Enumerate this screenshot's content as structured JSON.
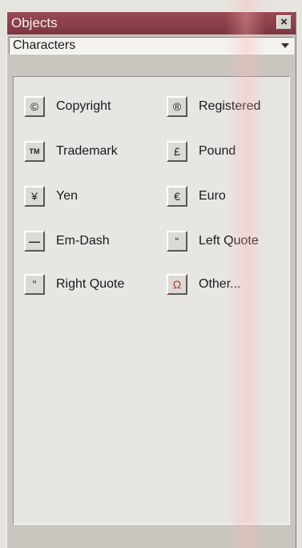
{
  "window": {
    "title": "Objects",
    "close_symbol": "×"
  },
  "dropdown": {
    "selected": "Characters"
  },
  "items": [
    {
      "label": "Copyright",
      "icon": "copyright-icon",
      "glyph": "©"
    },
    {
      "label": "Registered",
      "icon": "registered-icon",
      "glyph": "®"
    },
    {
      "label": "Trademark",
      "icon": "trademark-icon",
      "glyph": "TM"
    },
    {
      "label": "Pound",
      "icon": "pound-icon",
      "glyph": "£"
    },
    {
      "label": "Yen",
      "icon": "yen-icon",
      "glyph": "¥"
    },
    {
      "label": "Euro",
      "icon": "euro-icon",
      "glyph": "€"
    },
    {
      "label": "Em-Dash",
      "icon": "em-dash-icon",
      "glyph": "—"
    },
    {
      "label": "Left Quote",
      "icon": "left-quote-icon",
      "glyph": "“"
    },
    {
      "label": "Right Quote",
      "icon": "right-quote-icon",
      "glyph": "”"
    },
    {
      "label": "Other...",
      "icon": "other-characters-icon",
      "glyph": "Ω"
    }
  ],
  "colors": {
    "titlebar": "#8a3e48",
    "panel": "#e7e6e3",
    "frame": "#c9c6c0"
  }
}
